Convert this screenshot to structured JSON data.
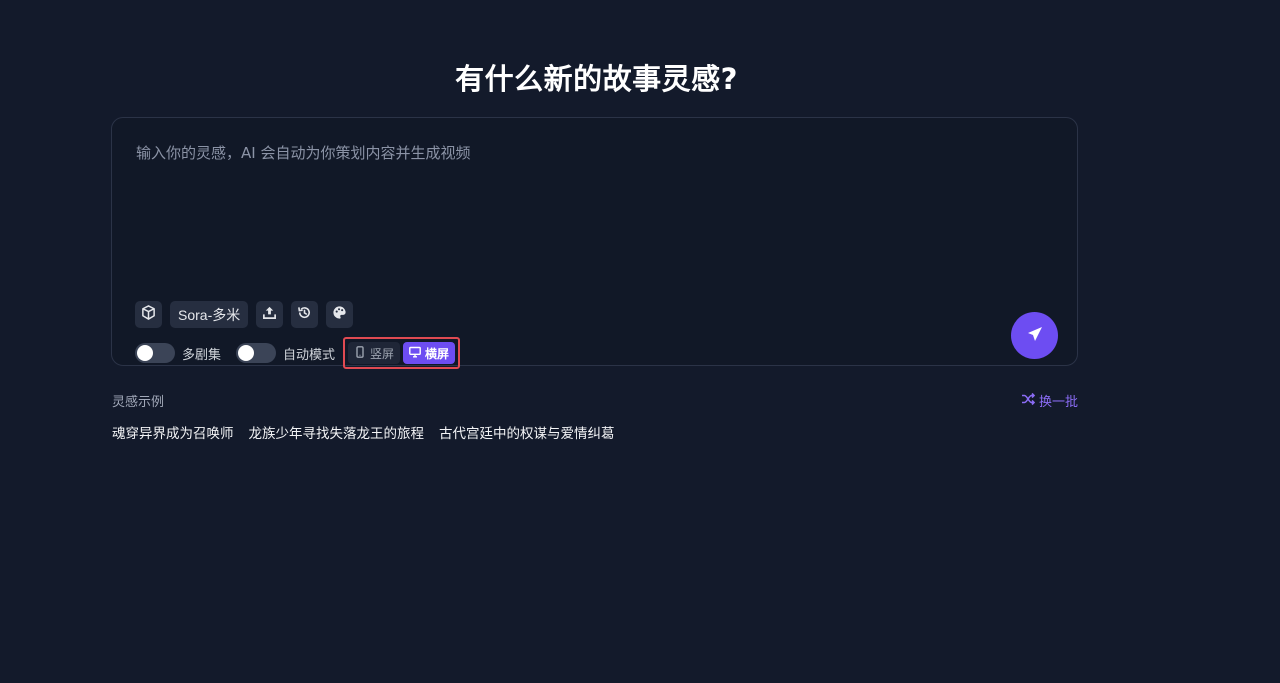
{
  "headline": "有什么新的故事灵感?",
  "composer": {
    "placeholder": "输入你的灵感，AI 会自动为你策划内容并生成视频",
    "value": "",
    "tools": [
      {
        "icon": "cube-icon"
      },
      {
        "icon": "model-selector",
        "label": "Sora-多米"
      },
      {
        "icon": "upload-icon"
      },
      {
        "icon": "history-icon"
      },
      {
        "icon": "palette-icon"
      }
    ],
    "model_label": "Sora-多米",
    "multi_episode": {
      "label": "多剧集",
      "enabled": false
    },
    "auto_mode": {
      "label": "自动模式",
      "enabled": false
    },
    "orientation": {
      "portrait_label": "竖屏",
      "landscape_label": "横屏",
      "selected": "横屏"
    },
    "send_icon": "paper-plane-icon"
  },
  "examples": {
    "label": "灵感示例",
    "shuffle_label": "换一批",
    "items": [
      "魂穿异界成为召唤师",
      "龙族少年寻找失落龙王的旅程",
      "古代宫廷中的权谋与爱情纠葛"
    ]
  },
  "colors": {
    "background": "#131a2b",
    "accent": "#6d4df2",
    "highlight_border": "#e04a52"
  }
}
